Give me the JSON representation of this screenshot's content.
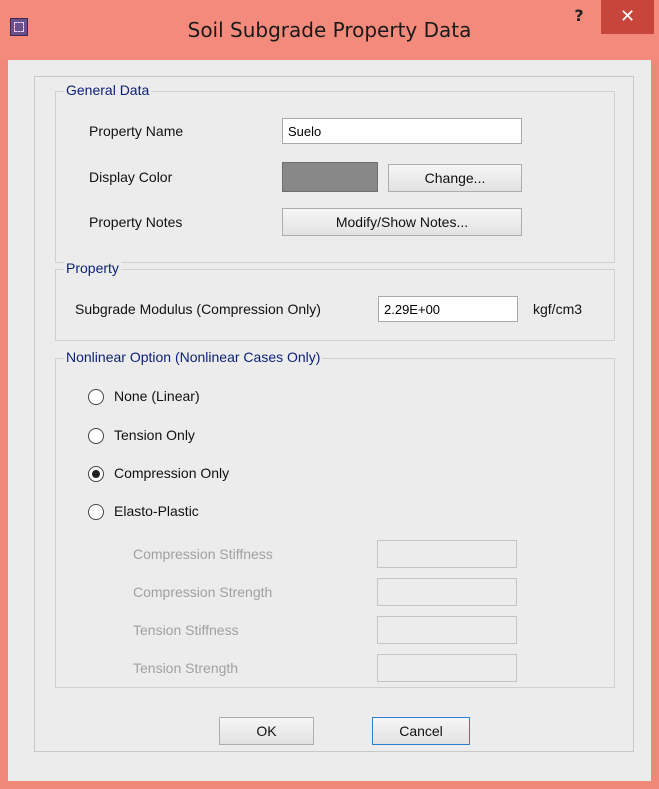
{
  "window": {
    "title": "Soil Subgrade Property Data",
    "help_label": "?",
    "close_label": "✕",
    "app_icon": "grid-icon"
  },
  "general": {
    "legend": "General Data",
    "property_name_label": "Property Name",
    "property_name_value": "Suelo",
    "display_color_label": "Display Color",
    "display_color": "#888888",
    "change_button": "Change...",
    "notes_label": "Property Notes",
    "notes_button": "Modify/Show Notes..."
  },
  "property": {
    "legend": "Property",
    "subgrade_label": "Subgrade Modulus  (Compression Only)",
    "subgrade_value": "2.29E+00",
    "subgrade_unit": "kgf/cm3"
  },
  "nonlinear": {
    "legend": "Nonlinear Option  (Nonlinear Cases Only)",
    "options": [
      {
        "label": "None (Linear)",
        "selected": false
      },
      {
        "label": "Tension Only",
        "selected": false
      },
      {
        "label": "Compression Only",
        "selected": true
      },
      {
        "label": "Elasto-Plastic",
        "selected": false
      }
    ],
    "fields": [
      {
        "label": "Compression Stiffness",
        "value": ""
      },
      {
        "label": "Compression Strength",
        "value": ""
      },
      {
        "label": "Tension Stiffness",
        "value": ""
      },
      {
        "label": "Tension Strength",
        "value": ""
      }
    ]
  },
  "buttons": {
    "ok": "OK",
    "cancel": "Cancel"
  }
}
